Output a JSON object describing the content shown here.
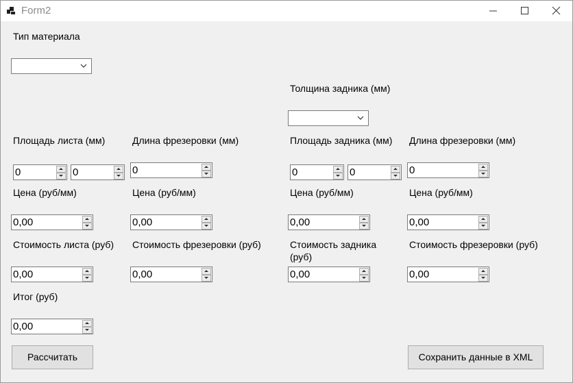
{
  "window": {
    "title": "Form2"
  },
  "labels": {
    "material_type": "Тип материала",
    "back_thickness": "Толщина задника (мм)",
    "sheet_area": "Площадь листа (мм)",
    "milling_length_left": "Длина фрезеровки (мм)",
    "back_area": "Площадь задника (мм)",
    "milling_length_right": "Длина фрезеровки (мм)",
    "price_1": "Цена (руб/мм)",
    "price_2": "Цена (руб/мм)",
    "price_3": "Цена (руб/мм)",
    "price_4": "Цена (руб/мм)",
    "sheet_cost": "Стоимость листа (руб)",
    "milling_cost_left": "Стоимость фрезеровки (руб)",
    "back_cost_line1": "Стоимость задника",
    "back_cost_line2": "(руб)",
    "milling_cost_right": "Стоимость фрезеровки (руб)",
    "total": "Итог (руб)"
  },
  "combos": {
    "material_type": "",
    "back_thickness": ""
  },
  "fields": {
    "sheet_w": "0",
    "sheet_h": "0",
    "milling_len_l": "0",
    "back_w": "0",
    "back_h": "0",
    "milling_len_r": "0",
    "price_sheet": "0,00",
    "price_milling_l": "0,00",
    "price_back": "0,00",
    "price_milling_r": "0,00",
    "cost_sheet": "0,00",
    "cost_milling_l": "0,00",
    "cost_back": "0,00",
    "cost_milling_r": "0,00",
    "total": "0,00"
  },
  "buttons": {
    "calculate": "Рассчитать",
    "save_xml": "Сохранить данные в XML"
  },
  "icons": {
    "app": "app-icon",
    "minimize": "minimize-icon",
    "maximize": "maximize-icon",
    "close": "close-icon"
  }
}
